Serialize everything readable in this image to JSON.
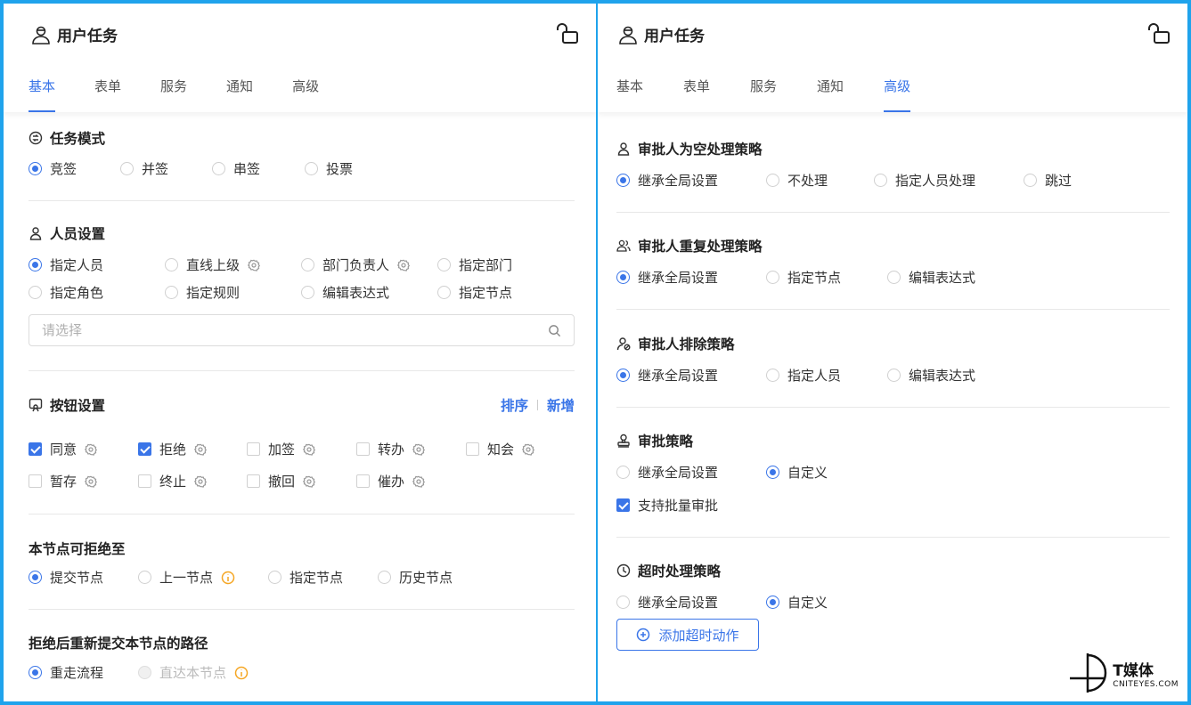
{
  "colors": {
    "accent": "#3a75e8",
    "warning": "#f5a623",
    "frame": "#1fa3ec"
  },
  "left": {
    "title": "用户任务",
    "tabs": [
      "基本",
      "表单",
      "服务",
      "通知",
      "高级"
    ],
    "active_tab": "基本",
    "task_mode": {
      "title": "任务模式",
      "options": [
        "竞签",
        "并签",
        "串签",
        "投票"
      ],
      "selected": "竞签"
    },
    "personnel": {
      "title": "人员设置",
      "options": [
        "指定人员",
        "直线上级",
        "部门负责人",
        "指定部门",
        "指定角色",
        "指定规则",
        "编辑表达式",
        "指定节点"
      ],
      "selected": "指定人员",
      "placeholder": "请选择"
    },
    "buttons": {
      "title": "按钮设置",
      "sort_label": "排序",
      "add_label": "新增",
      "items": [
        "同意",
        "拒绝",
        "加签",
        "转办",
        "知会",
        "暂存",
        "终止",
        "撤回",
        "催办"
      ],
      "checked": [
        "同意",
        "拒绝"
      ]
    },
    "reject_to": {
      "title": "本节点可拒绝至",
      "options": [
        "提交节点",
        "上一节点",
        "指定节点",
        "历史节点"
      ],
      "selected": "提交节点"
    },
    "resubmit_path": {
      "title": "拒绝后重新提交本节点的路径",
      "options": [
        "重走流程",
        "直达本节点"
      ],
      "selected": "重走流程"
    }
  },
  "right": {
    "title": "用户任务",
    "tabs": [
      "基本",
      "表单",
      "服务",
      "通知",
      "高级"
    ],
    "active_tab": "高级",
    "empty_approver": {
      "title": "审批人为空处理策略",
      "options": [
        "继承全局设置",
        "不处理",
        "指定人员处理",
        "跳过"
      ],
      "selected": "继承全局设置"
    },
    "duplicate_approver": {
      "title": "审批人重复处理策略",
      "options": [
        "继承全局设置",
        "指定节点",
        "编辑表达式"
      ],
      "selected": "继承全局设置"
    },
    "exclude_approver": {
      "title": "审批人排除策略",
      "options": [
        "继承全局设置",
        "指定人员",
        "编辑表达式"
      ],
      "selected": "继承全局设置"
    },
    "approval_policy": {
      "title": "审批策略",
      "options": [
        "继承全局设置",
        "自定义"
      ],
      "selected": "自定义",
      "batch_label": "支持批量审批",
      "batch_checked": true
    },
    "timeout_policy": {
      "title": "超时处理策略",
      "options": [
        "继承全局设置",
        "自定义"
      ],
      "selected": "自定义",
      "add_action_label": "添加超时动作"
    }
  },
  "watermark": {
    "name": "T媒体",
    "sub": "CNITEYES.COM"
  }
}
